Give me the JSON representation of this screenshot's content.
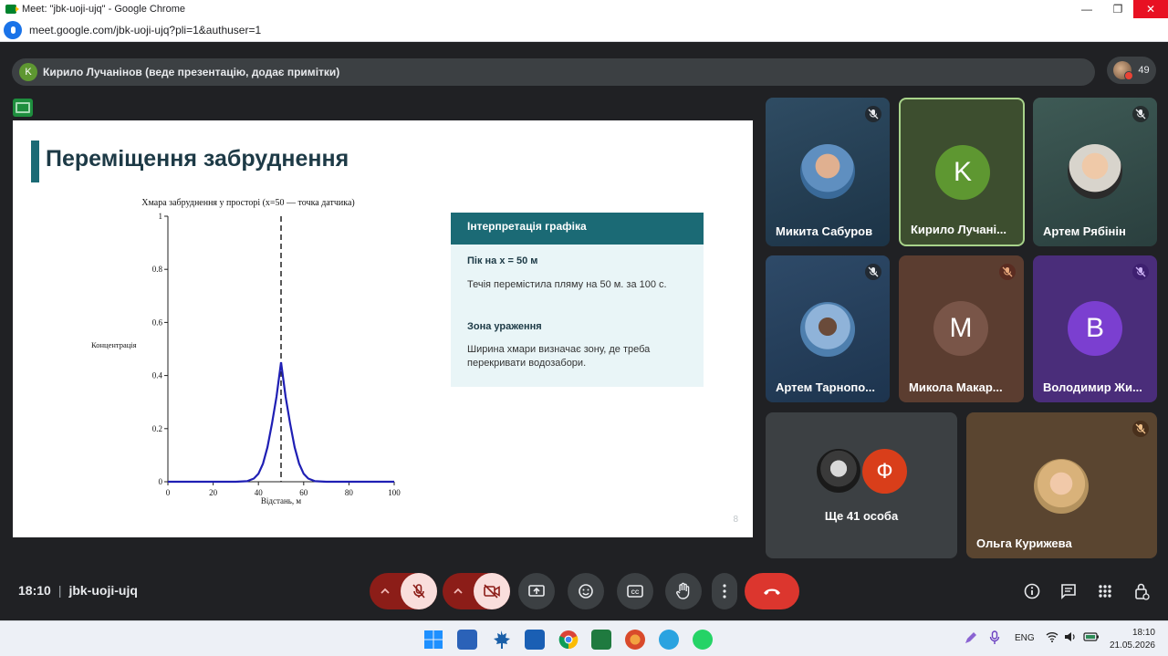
{
  "browser": {
    "window_title": "Meet: \"jbk-uoji-ujq\" - Google Chrome",
    "url": "meet.google.com/jbk-uoji-ujq?pli=1&authuser=1"
  },
  "presenter": {
    "initial": "K",
    "label": "Кирило Лучанінов (веде презентацію, додає примітки)",
    "participant_count": "49"
  },
  "slide": {
    "title": "Переміщення забруднення",
    "page_number": "8",
    "info_box": {
      "header": "Інтерпретація графіка",
      "section1_title": "Пік на x = 50 м",
      "section1_text": "Течія  перемістила пляму на 50 м. за 100 с.",
      "section2_title": "Зона ураження",
      "section2_text": "Ширина хмари визначає зону, де треба перекривати водозабори."
    }
  },
  "chart_data": {
    "type": "line",
    "title": "Хмара забруднення у просторі (x=50 — точка датчика)",
    "xlabel": "Відстань, м",
    "ylabel": "Концентрація",
    "xlim": [
      0,
      100
    ],
    "ylim": [
      0,
      1
    ],
    "xticks": [
      "0",
      "20",
      "40",
      "60",
      "80",
      "100"
    ],
    "yticks": [
      "0",
      "0.2",
      "0.4",
      "0.6",
      "0.8",
      "1"
    ],
    "series": [
      {
        "color": "#1f1fb4",
        "x": [
          0,
          10,
          20,
          30,
          35,
          38,
          40,
          42,
          44,
          46,
          48,
          50,
          52,
          54,
          56,
          58,
          60,
          62,
          65,
          70,
          80,
          90,
          100
        ],
        "y": [
          0,
          0,
          0,
          0,
          0.002,
          0.012,
          0.03,
          0.068,
          0.13,
          0.22,
          0.32,
          0.45,
          0.32,
          0.22,
          0.13,
          0.068,
          0.03,
          0.012,
          0.002,
          0,
          0,
          0,
          0
        ]
      }
    ],
    "vline": {
      "x": 50,
      "style": "dashed"
    },
    "grid": false,
    "legend": "none"
  },
  "tiles": [
    {
      "name": "Микита Сабуров",
      "muted": true
    },
    {
      "name": "Кирило Лучані...",
      "initial": "K",
      "avatar_color": "#5e9731",
      "active_speaker": true
    },
    {
      "name": "Артем Рябінін",
      "muted": true
    },
    {
      "name": "Артем Тарнопо...",
      "muted": true
    },
    {
      "name": "Микола Макар...",
      "initial": "M",
      "avatar_color": "#795548",
      "muted": true
    },
    {
      "name": "Володимир Жи...",
      "initial": "B",
      "avatar_color": "#7b3fd0",
      "muted": true
    },
    {
      "name": "Ще 41 особа",
      "initial": "Ф",
      "avatar_color": "#d93e1a"
    },
    {
      "name": "Ольга Курижева",
      "muted": true
    }
  ],
  "bottom_bar": {
    "time": "18:10",
    "meeting_code": "jbk-uoji-ujq"
  },
  "taskbar": {
    "language": "ENG",
    "clock_time": "18:10",
    "clock_date": "21.05.2026"
  },
  "colors": {
    "accent_teal": "#1b6a75",
    "leave_red": "#dc362e",
    "active_border": "#a8d38a"
  }
}
